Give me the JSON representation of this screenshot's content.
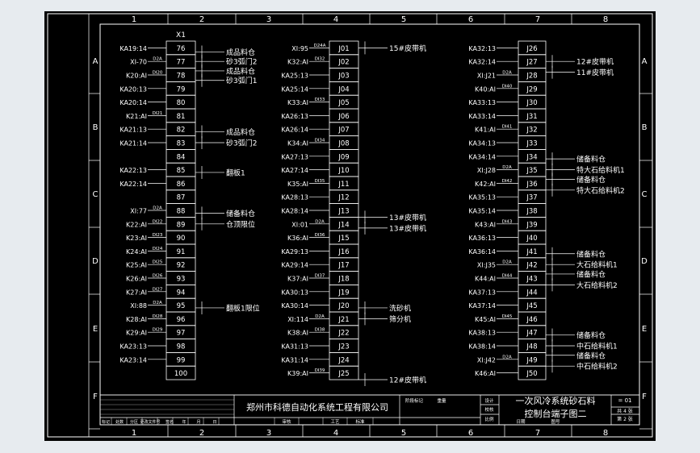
{
  "grid": {
    "columns": [
      "1",
      "2",
      "3",
      "4",
      "5",
      "6",
      "7",
      "8"
    ],
    "rows": [
      "A",
      "B",
      "C",
      "D",
      "E",
      "F"
    ]
  },
  "terminal_blocks": [
    {
      "header": "X1",
      "terminals": [
        {
          "label": "KA19:14",
          "wire": "",
          "num": "76"
        },
        {
          "label": "XI-70",
          "wire": "D2A",
          "num": "77"
        },
        {
          "label": "K20:AI",
          "wire": "DI20",
          "num": "78"
        },
        {
          "label": "KA20:13",
          "wire": "",
          "num": "79"
        },
        {
          "label": "KA20:14",
          "wire": "",
          "num": "80"
        },
        {
          "label": "K21:AI",
          "wire": "DI21",
          "num": "81"
        },
        {
          "label": "KA21:13",
          "wire": "",
          "num": "82"
        },
        {
          "label": "KA21:14",
          "wire": "",
          "num": "83"
        },
        {
          "label": "",
          "wire": "",
          "num": "84"
        },
        {
          "label": "KA22:13",
          "wire": "",
          "num": "85"
        },
        {
          "label": "KA22:14",
          "wire": "",
          "num": "86"
        },
        {
          "label": "",
          "wire": "",
          "num": "87"
        },
        {
          "label": "XI:77",
          "wire": "D2A",
          "num": "88"
        },
        {
          "label": "K22:AI",
          "wire": "DI22",
          "num": "89"
        },
        {
          "label": "K23:AI",
          "wire": "DI23",
          "num": "90"
        },
        {
          "label": "K24:AI",
          "wire": "DI24",
          "num": "91"
        },
        {
          "label": "K25:AI",
          "wire": "DI25",
          "num": "92"
        },
        {
          "label": "K26:AI",
          "wire": "DI26",
          "num": "93"
        },
        {
          "label": "K27:AI",
          "wire": "DI27",
          "num": "94"
        },
        {
          "label": "XI:88",
          "wire": "D2A",
          "num": "95"
        },
        {
          "label": "K28:AI",
          "wire": "DI28",
          "num": "96"
        },
        {
          "label": "K29:AI",
          "wire": "DI29",
          "num": "97"
        },
        {
          "label": "KA23:13",
          "wire": "",
          "num": "98"
        },
        {
          "label": "KA23:14",
          "wire": "",
          "num": "99"
        },
        {
          "label": "",
          "wire": "",
          "num": "100"
        }
      ]
    },
    {
      "header": "",
      "terminals": [
        {
          "label": "XI:95",
          "wire": "D24A",
          "num": "J01"
        },
        {
          "label": "K32:AI",
          "wire": "DI32",
          "num": "J02"
        },
        {
          "label": "KA25:13",
          "wire": "",
          "num": "J03"
        },
        {
          "label": "KA25:14",
          "wire": "",
          "num": "J04"
        },
        {
          "label": "K33:AI",
          "wire": "DI33",
          "num": "J05"
        },
        {
          "label": "KA26:13",
          "wire": "",
          "num": "J06"
        },
        {
          "label": "KA26:14",
          "wire": "",
          "num": "J07"
        },
        {
          "label": "K34:AI",
          "wire": "DI34",
          "num": "J08"
        },
        {
          "label": "KA27:13",
          "wire": "",
          "num": "J09"
        },
        {
          "label": "KA27:14",
          "wire": "",
          "num": "J10"
        },
        {
          "label": "K35:AI",
          "wire": "DI35",
          "num": "J11"
        },
        {
          "label": "KA28:13",
          "wire": "",
          "num": "J12"
        },
        {
          "label": "KA28:14",
          "wire": "",
          "num": "J13"
        },
        {
          "label": "XI:01",
          "wire": "D2A",
          "num": "J14"
        },
        {
          "label": "K36:AI",
          "wire": "DI36",
          "num": "J15"
        },
        {
          "label": "KA29:13",
          "wire": "",
          "num": "J16"
        },
        {
          "label": "KA29:14",
          "wire": "",
          "num": "J17"
        },
        {
          "label": "K37:AI",
          "wire": "DI37",
          "num": "J18"
        },
        {
          "label": "KA30:13",
          "wire": "",
          "num": "J19"
        },
        {
          "label": "KA30:14",
          "wire": "",
          "num": "J20"
        },
        {
          "label": "XI:114",
          "wire": "D2A",
          "num": "J21"
        },
        {
          "label": "K38:AI",
          "wire": "DI38",
          "num": "J22"
        },
        {
          "label": "KA31:13",
          "wire": "",
          "num": "J23"
        },
        {
          "label": "KA31:14",
          "wire": "",
          "num": "J24"
        },
        {
          "label": "K39:AI",
          "wire": "DI39",
          "num": "J25"
        }
      ]
    },
    {
      "header": "",
      "terminals": [
        {
          "label": "KA32:13",
          "wire": "",
          "num": "J26"
        },
        {
          "label": "KA32:14",
          "wire": "",
          "num": "J27"
        },
        {
          "label": "XI:J21",
          "wire": "D2A",
          "num": "J28"
        },
        {
          "label": "K40:AI",
          "wire": "DI40",
          "num": "J29"
        },
        {
          "label": "KA33:13",
          "wire": "",
          "num": "J30"
        },
        {
          "label": "KA33:14",
          "wire": "",
          "num": "J31"
        },
        {
          "label": "K41:AI",
          "wire": "DI41",
          "num": "J32"
        },
        {
          "label": "KA34:13",
          "wire": "",
          "num": "J33"
        },
        {
          "label": "KA34:14",
          "wire": "",
          "num": "J34"
        },
        {
          "label": "XI:J28",
          "wire": "D2A",
          "num": "J35"
        },
        {
          "label": "K42:AI",
          "wire": "DI42",
          "num": "J36"
        },
        {
          "label": "KA35:13",
          "wire": "",
          "num": "J37"
        },
        {
          "label": "KA35:14",
          "wire": "",
          "num": "J38"
        },
        {
          "label": "K43:AI",
          "wire": "DI43",
          "num": "J39"
        },
        {
          "label": "KA36:13",
          "wire": "",
          "num": "J40"
        },
        {
          "label": "KA36:14",
          "wire": "",
          "num": "J41"
        },
        {
          "label": "XI:J35",
          "wire": "D2A",
          "num": "J42"
        },
        {
          "label": "K44:AI",
          "wire": "DI44",
          "num": "J43"
        },
        {
          "label": "KA37:13",
          "wire": "",
          "num": "J44"
        },
        {
          "label": "KA37:14",
          "wire": "",
          "num": "J45"
        },
        {
          "label": "K45:AI",
          "wire": "DI45",
          "num": "J46"
        },
        {
          "label": "KA38:13",
          "wire": "",
          "num": "J47"
        },
        {
          "label": "KA38:14",
          "wire": "",
          "num": "J48"
        },
        {
          "label": "XI:J42",
          "wire": "D2A",
          "num": "J49"
        },
        {
          "label": "K46:AI",
          "wire": "",
          "num": "J50"
        }
      ]
    }
  ],
  "annotations": [
    {
      "text": "成品料仓",
      "block": 0,
      "row": 0.3
    },
    {
      "text": "砂3弧门2",
      "block": 0,
      "row": 1.0
    },
    {
      "text": "成品料仓",
      "block": 0,
      "row": 1.7
    },
    {
      "text": "砂3弧门1",
      "block": 0,
      "row": 2.4
    },
    {
      "text": "成品料仓",
      "block": 0,
      "row": 6.2
    },
    {
      "text": "砂3弧门2",
      "block": 0,
      "row": 7.0
    },
    {
      "text": "翻板1",
      "block": 0,
      "row": 9.2
    },
    {
      "text": "储备料仓",
      "block": 0,
      "row": 12.2
    },
    {
      "text": "仓顶限位",
      "block": 0,
      "row": 13.0
    },
    {
      "text": "翻板1限位",
      "block": 0,
      "row": 19.2
    },
    {
      "text": "15#皮带机",
      "block": 1,
      "row": 0.0
    },
    {
      "text": "13#皮带机",
      "block": 1,
      "row": 12.5
    },
    {
      "text": "13#皮带机",
      "block": 1,
      "row": 13.3
    },
    {
      "text": "洗砂机",
      "block": 1,
      "row": 19.2
    },
    {
      "text": "筛分机",
      "block": 1,
      "row": 20.0
    },
    {
      "text": "12#皮带机",
      "block": 1,
      "row": 24.5
    },
    {
      "text": "12#皮带机",
      "block": 2,
      "row": 1.0
    },
    {
      "text": "11#皮带机",
      "block": 2,
      "row": 1.8
    },
    {
      "text": "储备料仓",
      "block": 2,
      "row": 8.2
    },
    {
      "text": "特大石给料机1",
      "block": 2,
      "row": 9.0
    },
    {
      "text": "储备料仓",
      "block": 2,
      "row": 9.7
    },
    {
      "text": "特大石给料机2",
      "block": 2,
      "row": 10.5
    },
    {
      "text": "储备料仓",
      "block": 2,
      "row": 15.2
    },
    {
      "text": "大石给料机1",
      "block": 2,
      "row": 16.0
    },
    {
      "text": "储备料仓",
      "block": 2,
      "row": 16.7
    },
    {
      "text": "大石给料机2",
      "block": 2,
      "row": 17.5
    },
    {
      "text": "储备料仓",
      "block": 2,
      "row": 21.2
    },
    {
      "text": "中石给料机1",
      "block": 2,
      "row": 22.0
    },
    {
      "text": "储备料仓",
      "block": 2,
      "row": 22.7
    },
    {
      "text": "中石给料机2",
      "block": 2,
      "row": 23.5
    }
  ],
  "title_block": {
    "company": "郑州市科德自动化系统工程有限公司",
    "title_line1": "一次风冷系统砂石料",
    "title_line2": "控制台端子图二",
    "drawing_no": "= 01",
    "sheet": "共 4 张",
    "sheet2": "第 2 张",
    "stage": "阶段标记",
    "weight": "重量",
    "scale": "比例",
    "design": "设计",
    "check": "校核",
    "approve": "审核",
    "process": "工艺",
    "standard": "标准",
    "bottom_headers": [
      "标记",
      "处数",
      "分区",
      "更改文件号",
      "签名",
      "年",
      "月",
      "日"
    ],
    "date_label": "日期",
    "code_label": "图号"
  },
  "colors": {
    "page_bg": "#e7ebef",
    "sheet_bg": "#000000",
    "line": "#ffffff",
    "text": "#ffffff"
  }
}
